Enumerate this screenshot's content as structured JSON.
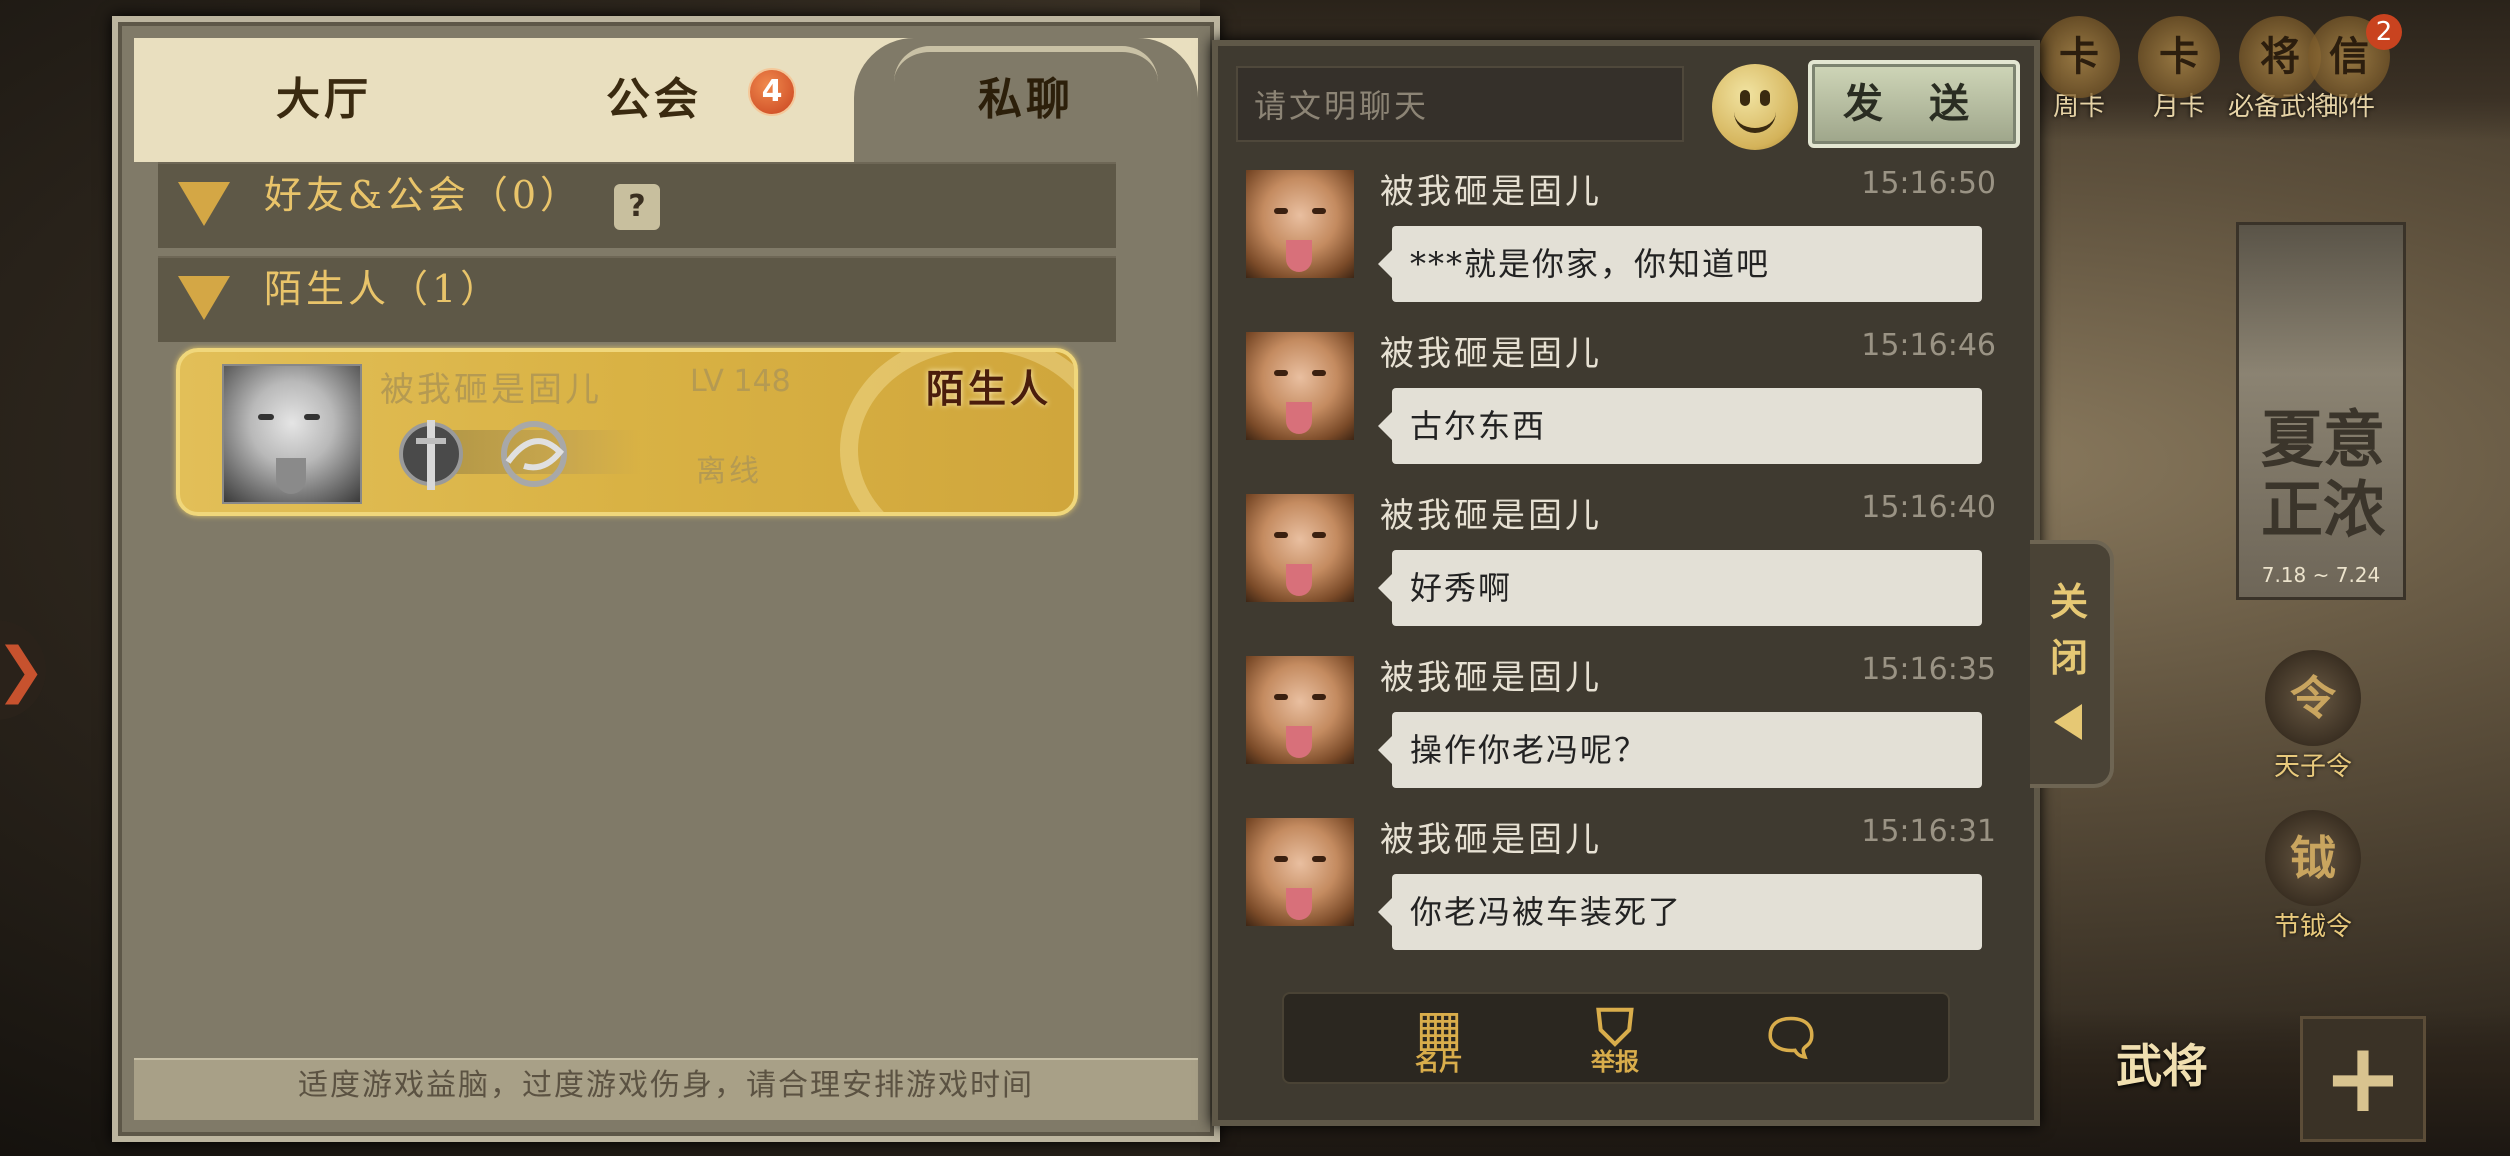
{
  "background": {
    "top_icons": [
      {
        "icon": "weekly-card-icon",
        "label": "周卡"
      },
      {
        "icon": "monthly-card-icon",
        "label": "月卡"
      },
      {
        "icon": "prepare-generals-icon",
        "label": "必备武将"
      },
      {
        "icon": "mail-icon",
        "label": "邮件",
        "badge": "2"
      }
    ],
    "event_banner": {
      "title": "夏意正浓",
      "date": "7.18 ~ 7.24"
    },
    "side_icons": [
      {
        "icon": "emperor-order-icon",
        "label": "天子令"
      },
      {
        "icon": "festival-order-icon",
        "label": "节钺令"
      }
    ],
    "bottom_buttons": [
      "武将"
    ]
  },
  "left_panel": {
    "tabs": [
      {
        "id": "hall",
        "label": "大厅"
      },
      {
        "id": "guild",
        "label": "公会",
        "badge": "4"
      },
      {
        "id": "private",
        "label": "私聊",
        "active": true
      }
    ],
    "groups": [
      {
        "label": "好友&公会（0）",
        "help": "?"
      },
      {
        "label": "陌生人（1）"
      }
    ],
    "friend_card": {
      "name": "被我砸是固儿",
      "level": "LV 148",
      "tag": "陌生人",
      "status": "离线"
    },
    "footer": "适度游戏益脑，过度游戏伤身，请合理安排游戏时间"
  },
  "chat": {
    "input_placeholder": "请文明聊天",
    "send_label": "发 送",
    "messages": [
      {
        "name": "被我砸是固儿",
        "time": "15:16:50",
        "text": "***就是你家，你知道吧"
      },
      {
        "name": "被我砸是固儿",
        "time": "15:16:46",
        "text": "古尔东西"
      },
      {
        "name": "被我砸是固儿",
        "time": "15:16:40",
        "text": "好秀啊"
      },
      {
        "name": "被我砸是固儿",
        "time": "15:16:35",
        "text": "操作你老冯呢？"
      },
      {
        "name": "被我砸是固儿",
        "time": "15:16:31",
        "text": "你老冯被车装死了"
      }
    ],
    "toolbar": [
      {
        "icon": "profile-card-icon",
        "label": "名片"
      },
      {
        "icon": "report-icon",
        "label": "举报"
      },
      {
        "icon": "clear-chat-icon",
        "label": ""
      }
    ],
    "close_tab_label": "关闭"
  }
}
